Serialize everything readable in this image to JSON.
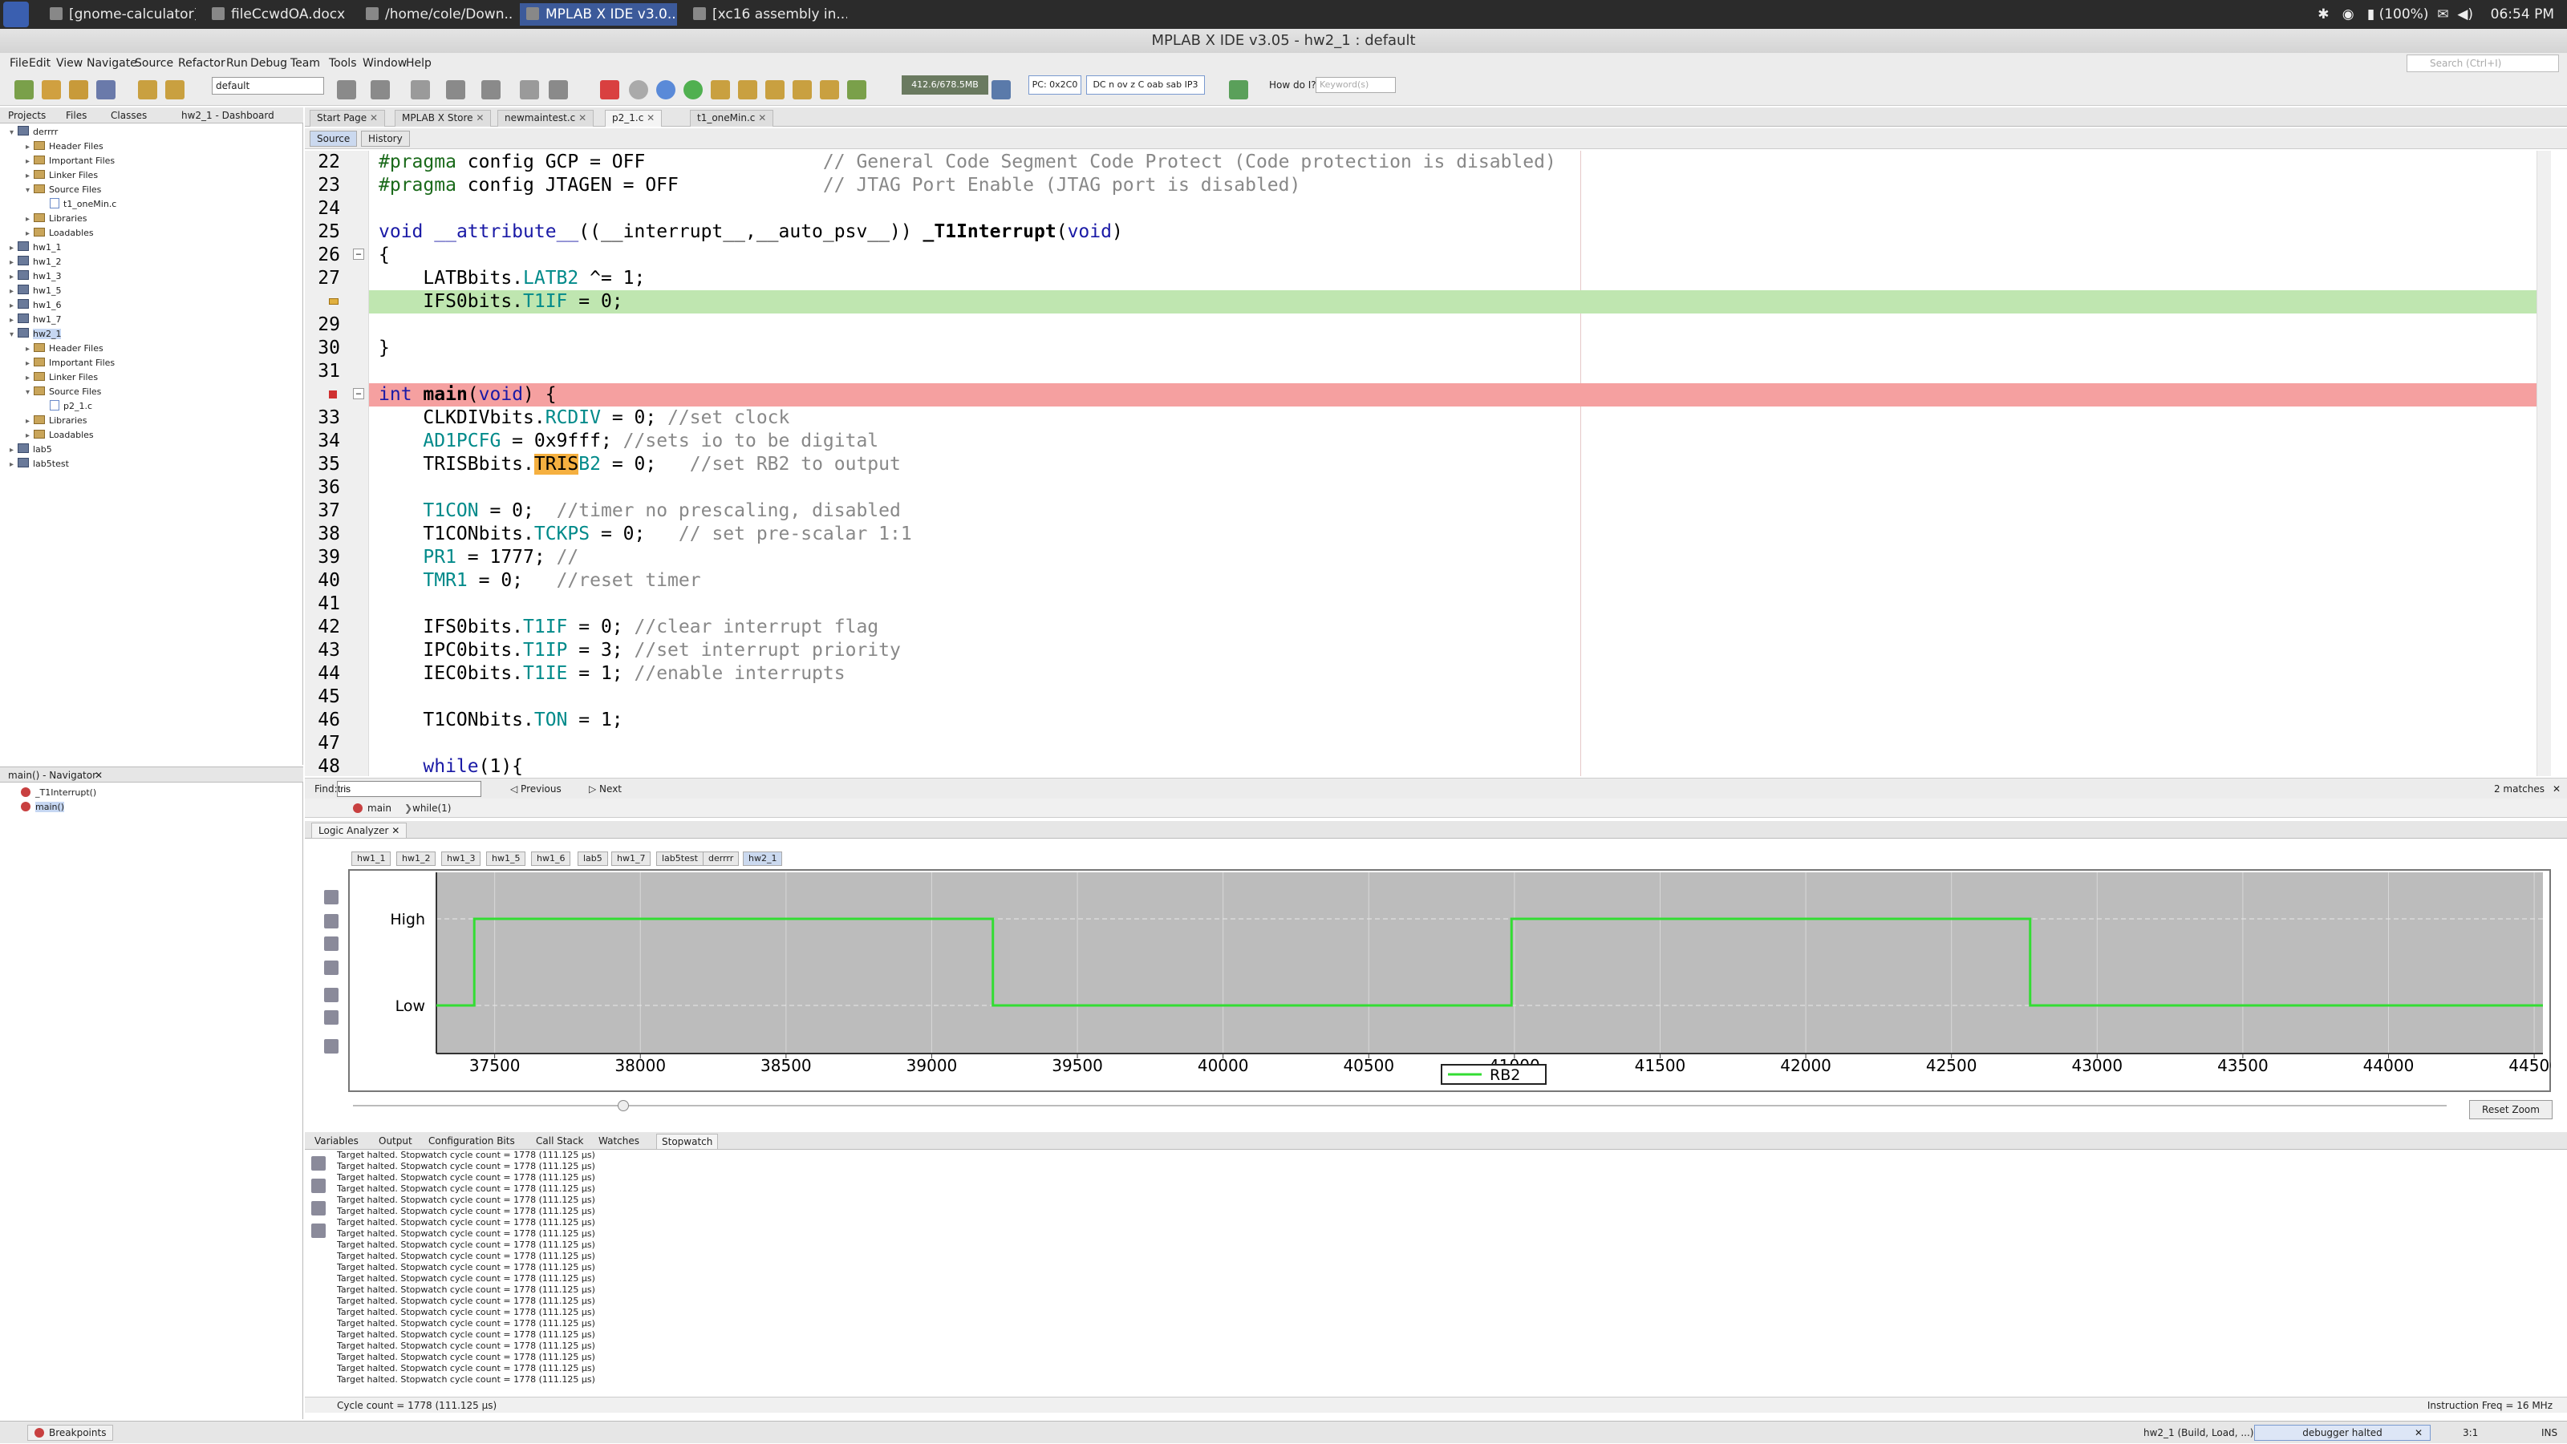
{
  "os": {
    "tasks": [
      "[gnome-calculator]",
      "fileCcwdOA.docx",
      "/home/cole/Down...",
      "MPLAB X IDE v3.0...",
      "[xc16 assembly in..."
    ],
    "active_task_index": 3,
    "battery": "(100%)",
    "clock": "06:54 PM"
  },
  "window": {
    "title": "MPLAB X IDE v3.05 - hw2_1 : default"
  },
  "menu": [
    "File",
    "Edit",
    "View",
    "Navigate",
    "Source",
    "Refactor",
    "Run",
    "Debug",
    "Team",
    "Tools",
    "Window",
    "Help"
  ],
  "search": {
    "placeholder": "Search (Ctrl+I)"
  },
  "toolbar": {
    "config": "default",
    "freq": "412.6/678.5MB",
    "pc": "PC: 0x2C0",
    "status_regs": "DC n ov z C oab sab IP3",
    "howdo": "How do I?",
    "keywords_placeholder": "Keyword(s)"
  },
  "left_tabs": [
    "Projects",
    "Files",
    "Classes",
    "hw2_1 - Dashboard"
  ],
  "project_tree": [
    {
      "label": "derrrr",
      "kind": "project",
      "depth": 0,
      "open": true
    },
    {
      "label": "Header Files",
      "kind": "folder",
      "depth": 1
    },
    {
      "label": "Important Files",
      "kind": "folder",
      "depth": 1
    },
    {
      "label": "Linker Files",
      "kind": "folder",
      "depth": 1
    },
    {
      "label": "Source Files",
      "kind": "folder",
      "depth": 1,
      "open": true
    },
    {
      "label": "t1_oneMin.c",
      "kind": "file",
      "depth": 2
    },
    {
      "label": "Libraries",
      "kind": "folder",
      "depth": 1
    },
    {
      "label": "Loadables",
      "kind": "folder",
      "depth": 1
    },
    {
      "label": "hw1_1",
      "kind": "project",
      "depth": 0
    },
    {
      "label": "hw1_2",
      "kind": "project",
      "depth": 0
    },
    {
      "label": "hw1_3",
      "kind": "project",
      "depth": 0
    },
    {
      "label": "hw1_5",
      "kind": "project",
      "depth": 0
    },
    {
      "label": "hw1_6",
      "kind": "project",
      "depth": 0
    },
    {
      "label": "hw1_7",
      "kind": "project",
      "depth": 0
    },
    {
      "label": "hw2_1",
      "kind": "project",
      "depth": 0,
      "open": true,
      "selected": true
    },
    {
      "label": "Header Files",
      "kind": "folder",
      "depth": 1
    },
    {
      "label": "Important Files",
      "kind": "folder",
      "depth": 1
    },
    {
      "label": "Linker Files",
      "kind": "folder",
      "depth": 1
    },
    {
      "label": "Source Files",
      "kind": "folder",
      "depth": 1,
      "open": true
    },
    {
      "label": "p2_1.c",
      "kind": "file",
      "depth": 2
    },
    {
      "label": "Libraries",
      "kind": "folder",
      "depth": 1
    },
    {
      "label": "Loadables",
      "kind": "folder",
      "depth": 1
    },
    {
      "label": "lab5",
      "kind": "project",
      "depth": 0
    },
    {
      "label": "lab5test",
      "kind": "project",
      "depth": 0
    }
  ],
  "navigator": {
    "title": "main() - Navigator",
    "items": [
      "_T1Interrupt()",
      "main()"
    ]
  },
  "editor_tabs": [
    {
      "label": "Start Page",
      "active": false
    },
    {
      "label": "MPLAB X Store",
      "active": false
    },
    {
      "label": "newmaintest.c",
      "active": false
    },
    {
      "label": "p2_1.c",
      "active": true
    },
    {
      "label": "t1_oneMin.c",
      "active": false
    }
  ],
  "editor_modes": [
    "Source",
    "History"
  ],
  "code_lines": [
    {
      "n": "22",
      "text": "#pragma config GCP = OFF                // General Code Segment Code Protect (Code protection is disabled)"
    },
    {
      "n": "23",
      "text": "#pragma config JTAGEN = OFF             // JTAG Port Enable (JTAG port is disabled)"
    },
    {
      "n": "24",
      "text": ""
    },
    {
      "n": "25",
      "text": "void __attribute__((__interrupt__,__auto_psv__)) _T1Interrupt(void)"
    },
    {
      "n": "26",
      "text": "{"
    },
    {
      "n": "27",
      "text": "    LATBbits.LATB2 ^= 1;"
    },
    {
      "n": "",
      "text": "    IFS0bits.T1IF = 0;",
      "highlight": "green"
    },
    {
      "n": "29",
      "text": ""
    },
    {
      "n": "30",
      "text": "}"
    },
    {
      "n": "31",
      "text": ""
    },
    {
      "n": "",
      "text": "int main(void) {",
      "highlight": "red"
    },
    {
      "n": "33",
      "text": "    CLKDIVbits.RCDIV = 0; //set clock"
    },
    {
      "n": "34",
      "text": "    AD1PCFG = 0x9fff; //sets io to be digital"
    },
    {
      "n": "35",
      "text": "    TRISBbits.TRISB2 = 0;   //set RB2 to output"
    },
    {
      "n": "36",
      "text": ""
    },
    {
      "n": "37",
      "text": "    T1CON = 0;  //timer no prescaling, disabled"
    },
    {
      "n": "38",
      "text": "    T1CONbits.TCKPS = 0;   // set pre-scalar 1:1"
    },
    {
      "n": "39",
      "text": "    PR1 = 1777; //"
    },
    {
      "n": "40",
      "text": "    TMR1 = 0;   //reset timer"
    },
    {
      "n": "41",
      "text": ""
    },
    {
      "n": "42",
      "text": "    IFS0bits.T1IF = 0; //clear interrupt flag"
    },
    {
      "n": "43",
      "text": "    IPC0bits.T1IP = 3; //set interrupt priority"
    },
    {
      "n": "44",
      "text": "    IEC0bits.T1IE = 1; //enable interrupts"
    },
    {
      "n": "45",
      "text": ""
    },
    {
      "n": "46",
      "text": "    T1CONbits.TON = 1;"
    },
    {
      "n": "47",
      "text": ""
    },
    {
      "n": "48",
      "text": "    while(1){"
    }
  ],
  "find": {
    "label": "Find:",
    "value": "tris",
    "previous": "Previous",
    "next": "Next",
    "matches": "2 matches"
  },
  "crumbs": [
    "main",
    "while(1)"
  ],
  "logic_analyzer": {
    "tab": "Logic Analyzer",
    "subtabs": [
      "hw1_1",
      "hw1_2",
      "hw1_3",
      "hw1_5",
      "hw1_6",
      "lab5",
      "hw1_7",
      "lab5test",
      "derrrr",
      "hw2_1"
    ],
    "active_subtab": "hw2_1",
    "reset_zoom": "Reset Zoom"
  },
  "chart_data": {
    "type": "line",
    "title": "",
    "xlabel": "",
    "ylabel": "",
    "x_ticks": [
      "37500",
      "38000",
      "38500",
      "39000",
      "39500",
      "40000",
      "40500",
      "41000",
      "41500",
      "42000",
      "42500",
      "43000",
      "43500",
      "44000",
      "44500"
    ],
    "xlim": [
      37300,
      44530
    ],
    "y_levels": [
      "High",
      "Low"
    ],
    "series": [
      {
        "name": "RB2",
        "color": "#33dd33",
        "points": [
          [
            37300,
            0
          ],
          [
            37430,
            0
          ],
          [
            37430,
            1
          ],
          [
            39210,
            1
          ],
          [
            39210,
            0
          ],
          [
            40990,
            0
          ],
          [
            40990,
            1
          ],
          [
            42770,
            1
          ],
          [
            42770,
            0
          ],
          [
            44530,
            0
          ]
        ]
      }
    ],
    "grid": true,
    "legend": "bottom-center",
    "background": "#bcbcbc"
  },
  "output": {
    "tabs": [
      "Variables",
      "Output",
      "Configuration Bits",
      "Call Stack",
      "Watches",
      "Stopwatch"
    ],
    "active_tab": "Stopwatch",
    "line": "Target halted. Stopwatch cycle count = 1778 (111.125 µs)",
    "line_count": 21,
    "cycle_count": "Cycle count =   1778 (111.125 µs)",
    "instruction_freq": "Instruction Freq = 16 MHz"
  },
  "statusbar": {
    "breakpoints": "Breakpoints",
    "build": "hw2_1 (Build, Load, ...)",
    "debugger": "debugger halted",
    "pos": "3:1",
    "mode": "INS"
  }
}
